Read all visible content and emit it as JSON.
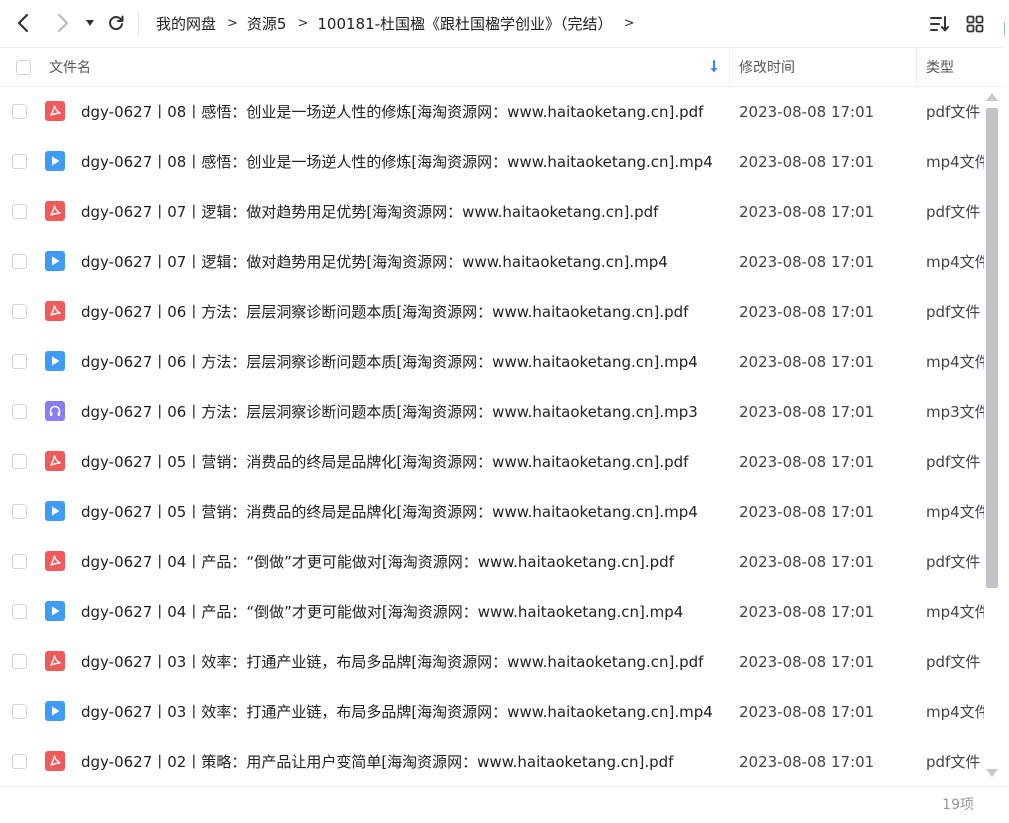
{
  "toolbar": {
    "back_icon": "chevron-left-icon",
    "forward_icon": "chevron-right-icon",
    "history_icon": "caret-down-icon",
    "refresh_icon": "refresh-icon",
    "sort_icon": "sort-list-icon",
    "grid_icon": "grid-view-icon"
  },
  "breadcrumb": {
    "items": [
      "我的网盘",
      "资源5",
      "100181-杜国楹《跟杜国楹学创业》（完结）"
    ],
    "separator": ">"
  },
  "columns": {
    "name": "文件名",
    "modified": "修改时间",
    "type": "类型"
  },
  "files": [
    {
      "name": "dgy-0627丨08丨感悟：创业是一场逆人性的修炼[海淘资源网：www.haitaoketang.cn].pdf",
      "time": "2023-08-08 17:01",
      "type": "pdf文件",
      "kind": "pdf"
    },
    {
      "name": "dgy-0627丨08丨感悟：创业是一场逆人性的修炼[海淘资源网：www.haitaoketang.cn].mp4",
      "time": "2023-08-08 17:01",
      "type": "mp4文件",
      "kind": "mp4"
    },
    {
      "name": "dgy-0627丨07丨逻辑：做对趋势用足优势[海淘资源网：www.haitaoketang.cn].pdf",
      "time": "2023-08-08 17:01",
      "type": "pdf文件",
      "kind": "pdf"
    },
    {
      "name": "dgy-0627丨07丨逻辑：做对趋势用足优势[海淘资源网：www.haitaoketang.cn].mp4",
      "time": "2023-08-08 17:01",
      "type": "mp4文件",
      "kind": "mp4"
    },
    {
      "name": "dgy-0627丨06丨方法：层层洞察诊断问题本质[海淘资源网：www.haitaoketang.cn].pdf",
      "time": "2023-08-08 17:01",
      "type": "pdf文件",
      "kind": "pdf"
    },
    {
      "name": "dgy-0627丨06丨方法：层层洞察诊断问题本质[海淘资源网：www.haitaoketang.cn].mp4",
      "time": "2023-08-08 17:01",
      "type": "mp4文件",
      "kind": "mp4"
    },
    {
      "name": "dgy-0627丨06丨方法：层层洞察诊断问题本质[海淘资源网：www.haitaoketang.cn].mp3",
      "time": "2023-08-08 17:01",
      "type": "mp3文件",
      "kind": "mp3"
    },
    {
      "name": "dgy-0627丨05丨营销：消费品的终局是品牌化[海淘资源网：www.haitaoketang.cn].pdf",
      "time": "2023-08-08 17:01",
      "type": "pdf文件",
      "kind": "pdf"
    },
    {
      "name": "dgy-0627丨05丨营销：消费品的终局是品牌化[海淘资源网：www.haitaoketang.cn].mp4",
      "time": "2023-08-08 17:01",
      "type": "mp4文件",
      "kind": "mp4"
    },
    {
      "name": "dgy-0627丨04丨产品：“倒做”才更可能做对[海淘资源网：www.haitaoketang.cn].pdf",
      "time": "2023-08-08 17:01",
      "type": "pdf文件",
      "kind": "pdf"
    },
    {
      "name": "dgy-0627丨04丨产品：“倒做”才更可能做对[海淘资源网：www.haitaoketang.cn].mp4",
      "time": "2023-08-08 17:01",
      "type": "mp4文件",
      "kind": "mp4"
    },
    {
      "name": "dgy-0627丨03丨效率：打通产业链，布局多品牌[海淘资源网：www.haitaoketang.cn].pdf",
      "time": "2023-08-08 17:01",
      "type": "pdf文件",
      "kind": "pdf"
    },
    {
      "name": "dgy-0627丨03丨效率：打通产业链，布局多品牌[海淘资源网：www.haitaoketang.cn].mp4",
      "time": "2023-08-08 17:01",
      "type": "mp4文件",
      "kind": "mp4"
    },
    {
      "name": "dgy-0627丨02丨策略：用产品让用户变简单[海淘资源网：www.haitaoketang.cn].pdf",
      "time": "2023-08-08 17:01",
      "type": "pdf文件",
      "kind": "pdf"
    }
  ],
  "footer": {
    "count": "19项"
  },
  "colors": {
    "pdf": "#f05a5a",
    "mp4": "#3f9cf5",
    "mp3": "#8a7cf2",
    "sort_arrow": "#2d8cf0"
  }
}
